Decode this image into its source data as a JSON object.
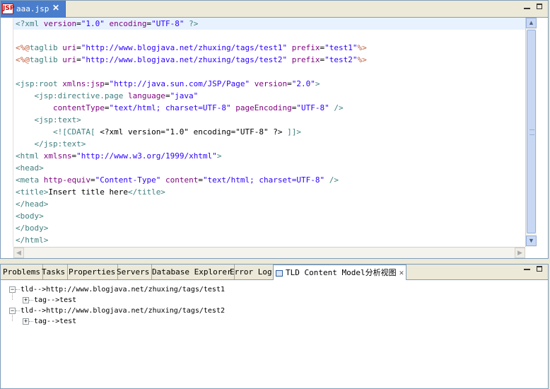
{
  "editor": {
    "tab_label": "aaa.jsp",
    "tab_icon_text": "JSP",
    "close_glyph": "✕",
    "lines": [
      [
        [
          "t-tag",
          "<?xml "
        ],
        [
          "t-attr",
          "version"
        ],
        [
          "t-text",
          "="
        ],
        [
          "t-val",
          "\"1.0\""
        ],
        [
          "t-text",
          " "
        ],
        [
          "t-attr",
          "encoding"
        ],
        [
          "t-text",
          "="
        ],
        [
          "t-val",
          "\"UTF-8\""
        ],
        [
          "t-text",
          " "
        ],
        [
          "t-tag",
          "?>"
        ]
      ],
      [],
      [
        [
          "t-dir",
          "<%@"
        ],
        [
          "t-tag",
          "taglib "
        ],
        [
          "t-attr",
          "uri"
        ],
        [
          "t-text",
          "="
        ],
        [
          "t-val",
          "\"http://www.blogjava.net/zhuxing/tags/test1\""
        ],
        [
          "t-text",
          " "
        ],
        [
          "t-attr",
          "prefix"
        ],
        [
          "t-text",
          "="
        ],
        [
          "t-val",
          "\"test1\""
        ],
        [
          "t-dir",
          "%>"
        ]
      ],
      [
        [
          "t-dir",
          "<%@"
        ],
        [
          "t-tag",
          "taglib "
        ],
        [
          "t-attr",
          "uri"
        ],
        [
          "t-text",
          "="
        ],
        [
          "t-val",
          "\"http://www.blogjava.net/zhuxing/tags/test2\""
        ],
        [
          "t-text",
          " "
        ],
        [
          "t-attr",
          "prefix"
        ],
        [
          "t-text",
          "="
        ],
        [
          "t-val",
          "\"test2\""
        ],
        [
          "t-dir",
          "%>"
        ]
      ],
      [],
      [
        [
          "t-tag",
          "<jsp:root "
        ],
        [
          "t-attr",
          "xmlns:jsp"
        ],
        [
          "t-text",
          "="
        ],
        [
          "t-val",
          "\"http://java.sun.com/JSP/Page\""
        ],
        [
          "t-text",
          " "
        ],
        [
          "t-attr",
          "version"
        ],
        [
          "t-text",
          "="
        ],
        [
          "t-val",
          "\"2.0\""
        ],
        [
          "t-tag",
          ">"
        ]
      ],
      [
        [
          "t-text",
          "    "
        ],
        [
          "t-tag",
          "<jsp:directive.page "
        ],
        [
          "t-attr",
          "language"
        ],
        [
          "t-text",
          "="
        ],
        [
          "t-val",
          "\"java\""
        ]
      ],
      [
        [
          "t-text",
          "        "
        ],
        [
          "t-attr",
          "contentType"
        ],
        [
          "t-text",
          "="
        ],
        [
          "t-val",
          "\"text/html; charset=UTF-8\""
        ],
        [
          "t-text",
          " "
        ],
        [
          "t-attr",
          "pageEncoding"
        ],
        [
          "t-text",
          "="
        ],
        [
          "t-val",
          "\"UTF-8\""
        ],
        [
          "t-text",
          " "
        ],
        [
          "t-tag",
          "/>"
        ]
      ],
      [
        [
          "t-text",
          "    "
        ],
        [
          "t-tag",
          "<jsp:text>"
        ]
      ],
      [
        [
          "t-text",
          "        "
        ],
        [
          "t-cdata",
          "<![CDATA[ "
        ],
        [
          "t-text",
          "<?xml version=\"1.0\" encoding=\"UTF-8\" ?> "
        ],
        [
          "t-cdata",
          "]]>"
        ]
      ],
      [
        [
          "t-text",
          "    "
        ],
        [
          "t-tag",
          "</jsp:text>"
        ]
      ],
      [
        [
          "t-tag",
          "<html "
        ],
        [
          "t-attr",
          "xmlsns"
        ],
        [
          "t-text",
          "="
        ],
        [
          "t-val",
          "\"http://www.w3.org/1999/xhtml\""
        ],
        [
          "t-tag",
          ">"
        ]
      ],
      [
        [
          "t-tag",
          "<head>"
        ]
      ],
      [
        [
          "t-tag",
          "<meta "
        ],
        [
          "t-attr",
          "http-equiv"
        ],
        [
          "t-text",
          "="
        ],
        [
          "t-val",
          "\"Content-Type\""
        ],
        [
          "t-text",
          " "
        ],
        [
          "t-attr",
          "content"
        ],
        [
          "t-text",
          "="
        ],
        [
          "t-val",
          "\"text/html; charset=UTF-8\""
        ],
        [
          "t-text",
          " "
        ],
        [
          "t-tag",
          "/>"
        ]
      ],
      [
        [
          "t-tag",
          "<title>"
        ],
        [
          "t-text",
          "Insert title here"
        ],
        [
          "t-tag",
          "</title>"
        ]
      ],
      [
        [
          "t-tag",
          "</head>"
        ]
      ],
      [
        [
          "t-tag",
          "<body>"
        ]
      ],
      [
        [
          "t-tag",
          "</body>"
        ]
      ],
      [
        [
          "t-tag",
          "</html>"
        ]
      ]
    ]
  },
  "views": {
    "tabs": [
      "Problems",
      "Tasks",
      "Properties",
      "Servers",
      "Database Explorer",
      "Error Log"
    ],
    "active_tab": "TLD Content Model分析视图",
    "close_glyph": "✕",
    "tree": [
      {
        "label": "tld-->http://www.blogjava.net/zhuxing/tags/test1",
        "expanded": true,
        "children": [
          {
            "label": "tag-->test"
          }
        ]
      },
      {
        "label": "tld-->http://www.blogjava.net/zhuxing/tags/test2",
        "expanded": true,
        "children": [
          {
            "label": "tag-->test"
          }
        ]
      }
    ]
  }
}
